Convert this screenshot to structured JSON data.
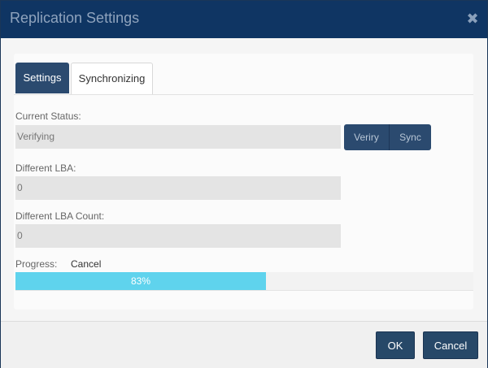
{
  "dialog": {
    "title": "Replication Settings",
    "close_symbol": "✖"
  },
  "tabs": [
    {
      "label": "Settings",
      "active": true
    },
    {
      "label": "Synchronizing",
      "active": false
    }
  ],
  "fields": {
    "current_status": {
      "label": "Current Status:",
      "value": "Verifying"
    },
    "different_lba": {
      "label": "Different LBA:",
      "value": "0"
    },
    "different_lba_count": {
      "label": "Different LBA Count:",
      "value": "0"
    }
  },
  "actions": {
    "verify_label": "Veriry",
    "sync_label": "Sync"
  },
  "progress": {
    "label": "Progress:",
    "cancel_label": "Cancel",
    "percent": 83,
    "percent_text": "83%"
  },
  "footer": {
    "ok_label": "OK",
    "cancel_label": "Cancel"
  },
  "colors": {
    "titlebar": "#0f3563",
    "accent": "#2b4a6f",
    "progress_fill": "#5fd3ed"
  },
  "icons": {
    "close": "close-icon"
  }
}
